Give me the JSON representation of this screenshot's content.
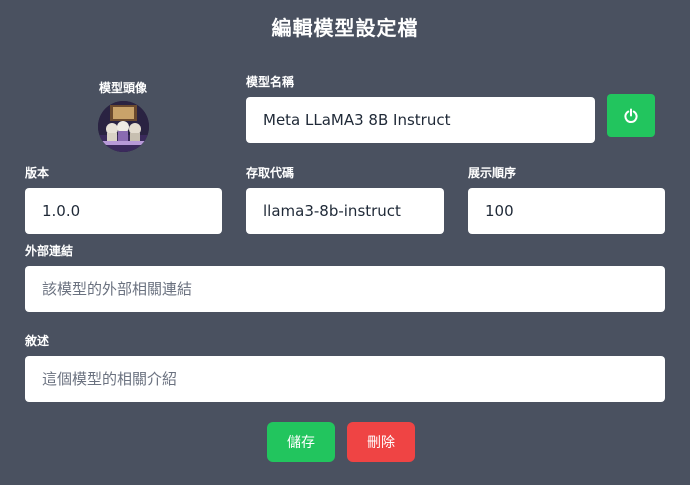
{
  "header": {
    "title": "編輯模型設定檔"
  },
  "avatar": {
    "label": "模型頭像"
  },
  "model_name": {
    "label": "模型名稱",
    "value": "Meta LLaMA3 8B Instruct"
  },
  "power_button": {
    "icon": "power-icon",
    "color": "#22c55e"
  },
  "version": {
    "label": "版本",
    "value": "1.0.0"
  },
  "access_code": {
    "label": "存取代碼",
    "value": "llama3-8b-instruct"
  },
  "display_order": {
    "label": "展示順序",
    "value": "100"
  },
  "external_link": {
    "label": "外部連結",
    "placeholder": "該模型的外部相關連結"
  },
  "description": {
    "label": "敘述",
    "placeholder": "這個模型的相關介紹"
  },
  "actions": {
    "save_label": "儲存",
    "delete_label": "刪除",
    "save_color": "#22c55e",
    "delete_color": "#ef4444"
  },
  "theme": {
    "background": "#4a5160"
  }
}
